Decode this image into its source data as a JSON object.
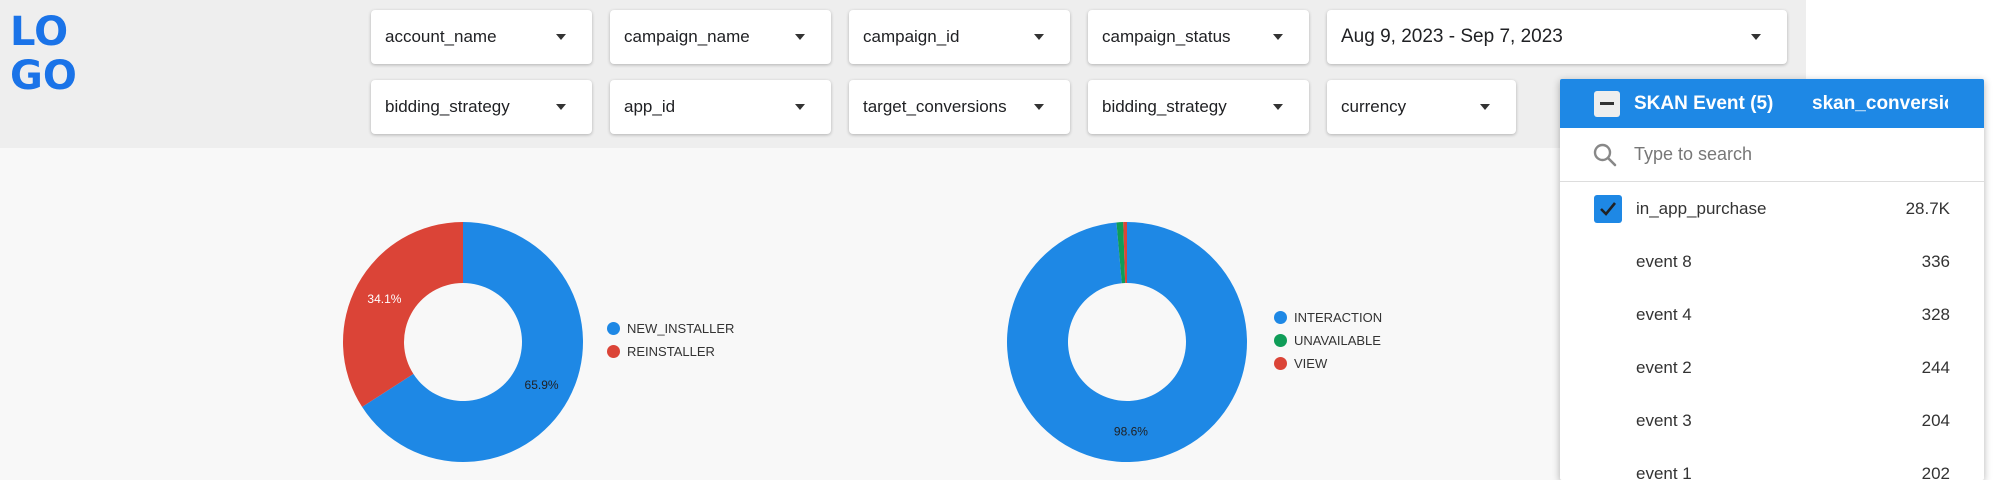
{
  "logo": {
    "line1": "LO",
    "line2": "GO"
  },
  "filters_row1": [
    {
      "label": "account_name"
    },
    {
      "label": "campaign_name"
    },
    {
      "label": "campaign_id"
    },
    {
      "label": "campaign_status"
    },
    {
      "label": "Aug 9, 2023 - Sep 7, 2023"
    }
  ],
  "filters_row2": [
    {
      "label": "bidding_strategy"
    },
    {
      "label": "app_id"
    },
    {
      "label": "target_conversions"
    },
    {
      "label": "bidding_strategy"
    },
    {
      "label": "currency"
    }
  ],
  "colors": {
    "blue": "#1e88e5",
    "red": "#db4437",
    "green": "#0f9d58",
    "logo": "#1a73e8"
  },
  "chart_data": [
    {
      "type": "pie",
      "donut": true,
      "legend_position": "right",
      "slices": [
        {
          "name": "NEW_INSTALLER",
          "value": 65.9,
          "label": "65.9%",
          "color": "#1e88e5"
        },
        {
          "name": "REINSTALLER",
          "value": 34.1,
          "label": "34.1%",
          "color": "#db4437"
        }
      ]
    },
    {
      "type": "pie",
      "donut": true,
      "legend_position": "right",
      "slices": [
        {
          "name": "INTERACTION",
          "value": 98.6,
          "label": "98.6%",
          "color": "#1e88e5"
        },
        {
          "name": "UNAVAILABLE",
          "value": 0.9,
          "label": "",
          "color": "#0f9d58"
        },
        {
          "name": "VIEW",
          "value": 0.5,
          "label": "",
          "color": "#db4437"
        }
      ]
    }
  ],
  "dropdown": {
    "title": "SKAN Event (5)",
    "column2": "skan_conversion_value",
    "search_placeholder": "Type to search",
    "items": [
      {
        "name": "in_app_purchase",
        "count": "28.7K",
        "checked": true
      },
      {
        "name": "event 8",
        "count": "336",
        "checked": false
      },
      {
        "name": "event 4",
        "count": "328",
        "checked": false
      },
      {
        "name": "event 2",
        "count": "244",
        "checked": false
      },
      {
        "name": "event 3",
        "count": "204",
        "checked": false
      },
      {
        "name": "event 1",
        "count": "202",
        "checked": false
      }
    ]
  }
}
